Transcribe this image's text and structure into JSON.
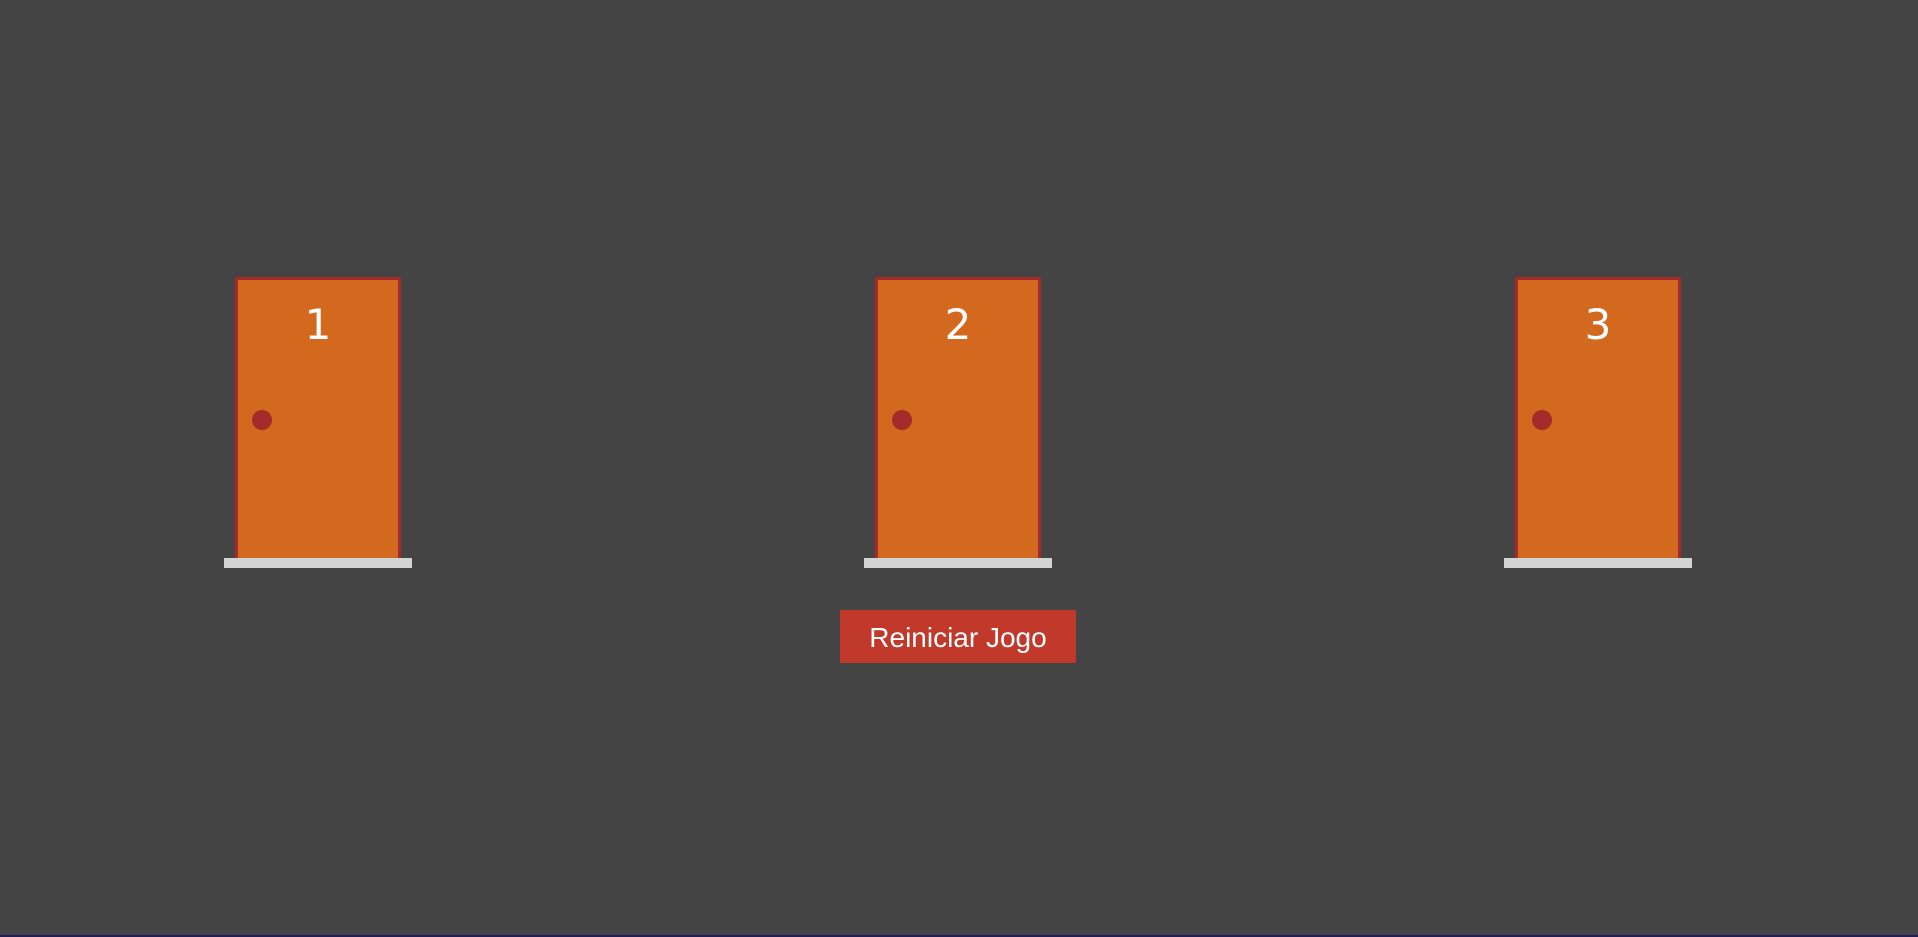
{
  "doors": [
    {
      "number": "1"
    },
    {
      "number": "2"
    },
    {
      "number": "3"
    }
  ],
  "controls": {
    "restart_label": "Reiniciar Jogo"
  },
  "colors": {
    "background": "#444444",
    "door": "#d2691e",
    "door_frame": "#a52a2a",
    "knob": "#a52a2a",
    "step": "#d3d3d3",
    "button": "#c0392b"
  }
}
